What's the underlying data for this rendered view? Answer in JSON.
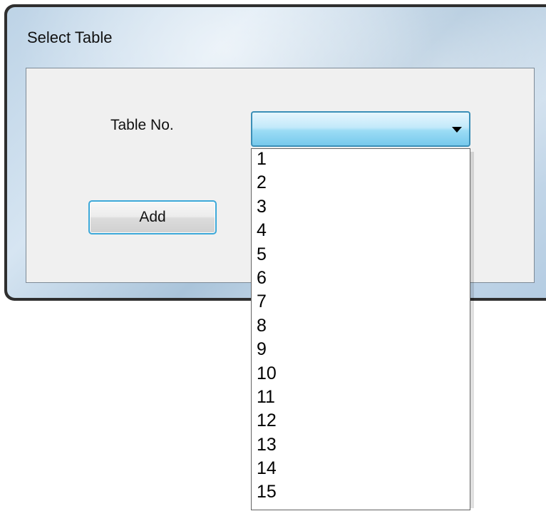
{
  "window": {
    "title": "Select Table"
  },
  "form": {
    "table_label": "Table No.",
    "add_label": "Add"
  },
  "combo": {
    "selected_value": "",
    "options": [
      "1",
      "2",
      "3",
      "4",
      "5",
      "6",
      "7",
      "8",
      "9",
      "10",
      "11",
      "12",
      "13",
      "14",
      "15"
    ]
  },
  "icons": {
    "dropdown_arrow": "chevron-down-icon"
  },
  "colors": {
    "combo_accent": "#77c9ec",
    "button_focus_border": "#3ca8d8"
  }
}
